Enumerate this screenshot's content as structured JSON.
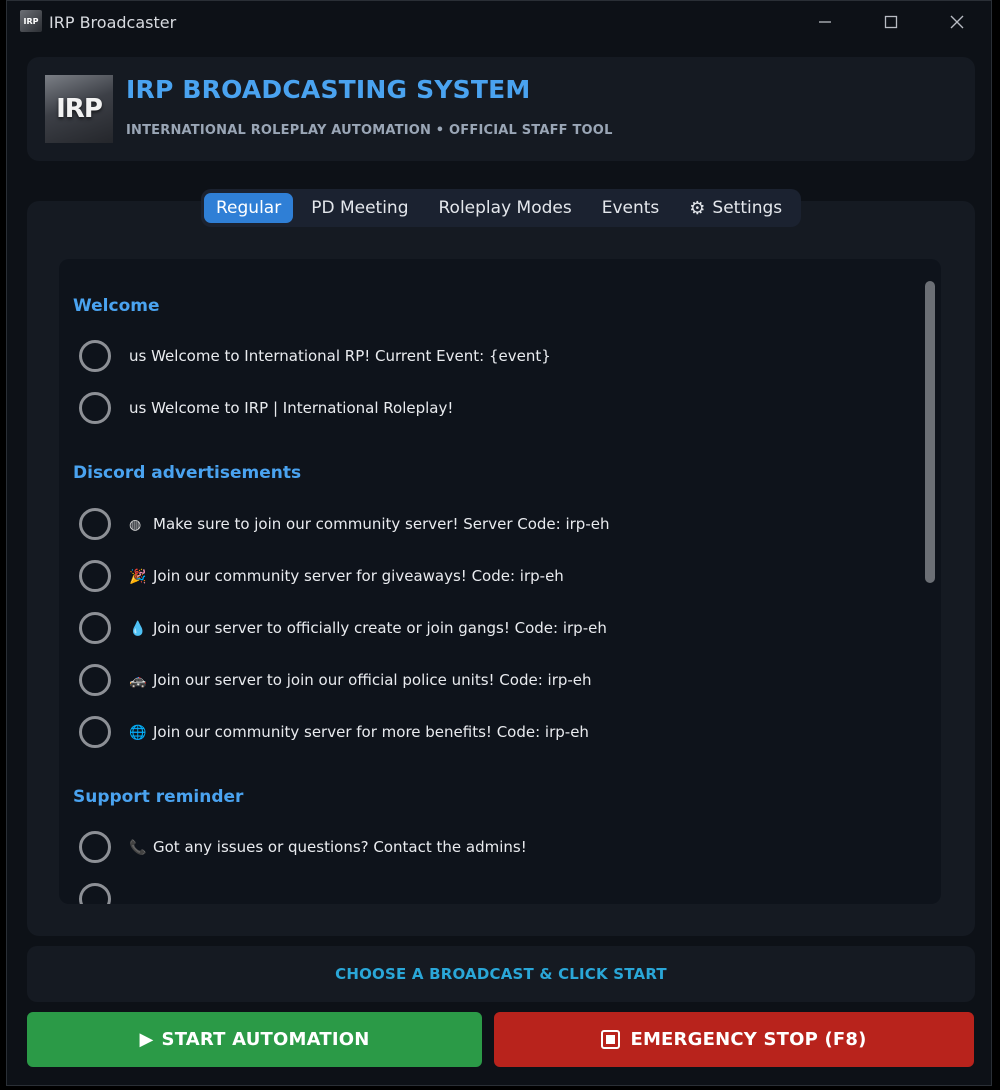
{
  "window": {
    "title": "IRP Broadcaster",
    "icon_label": "IRP"
  },
  "header": {
    "logo_text": "IRP",
    "title": "IRP BROADCASTING SYSTEM",
    "subtitle": "INTERNATIONAL ROLEPLAY AUTOMATION • OFFICIAL STAFF TOOL"
  },
  "tabs": [
    {
      "label": "Regular",
      "active": true
    },
    {
      "label": "PD Meeting",
      "active": false
    },
    {
      "label": "Roleplay Modes",
      "active": false
    },
    {
      "label": "Events",
      "active": false
    },
    {
      "label": "Settings",
      "active": false,
      "icon": "gear-icon"
    }
  ],
  "sections": [
    {
      "title": "Welcome",
      "items": [
        {
          "icon": "",
          "text": "us Welcome to International RP! Current Event: {event}"
        },
        {
          "icon": "",
          "text": "us Welcome to IRP | International Roleplay!"
        }
      ]
    },
    {
      "title": "Discord advertisements",
      "items": [
        {
          "icon": "◍",
          "text": "Make sure to join our community server! Server Code: irp-eh"
        },
        {
          "icon": "🎉",
          "text": "Join our community server for giveaways! Code: irp-eh"
        },
        {
          "icon": "💧",
          "text": "Join our server to officially create or join gangs! Code: irp-eh"
        },
        {
          "icon": "🚓",
          "text": "Join our server to join our official police units! Code: irp-eh"
        },
        {
          "icon": "🌐",
          "text": "Join our community server for more benefits! Code: irp-eh"
        }
      ]
    },
    {
      "title": "Support reminder",
      "items": [
        {
          "icon": "📞",
          "text": "Got any issues or questions? Contact the admins!"
        }
      ]
    }
  ],
  "status": {
    "text": "CHOOSE A BROADCAST & CLICK START"
  },
  "buttons": {
    "start_icon": "▶",
    "start_label": "START AUTOMATION",
    "stop_label": "EMERGENCY STOP (F8)"
  },
  "colors": {
    "accent": "#4aa3f0",
    "tab_active": "#2f7fd6",
    "start": "#2b9a47",
    "stop": "#b8231c",
    "status": "#2aa7d8"
  }
}
